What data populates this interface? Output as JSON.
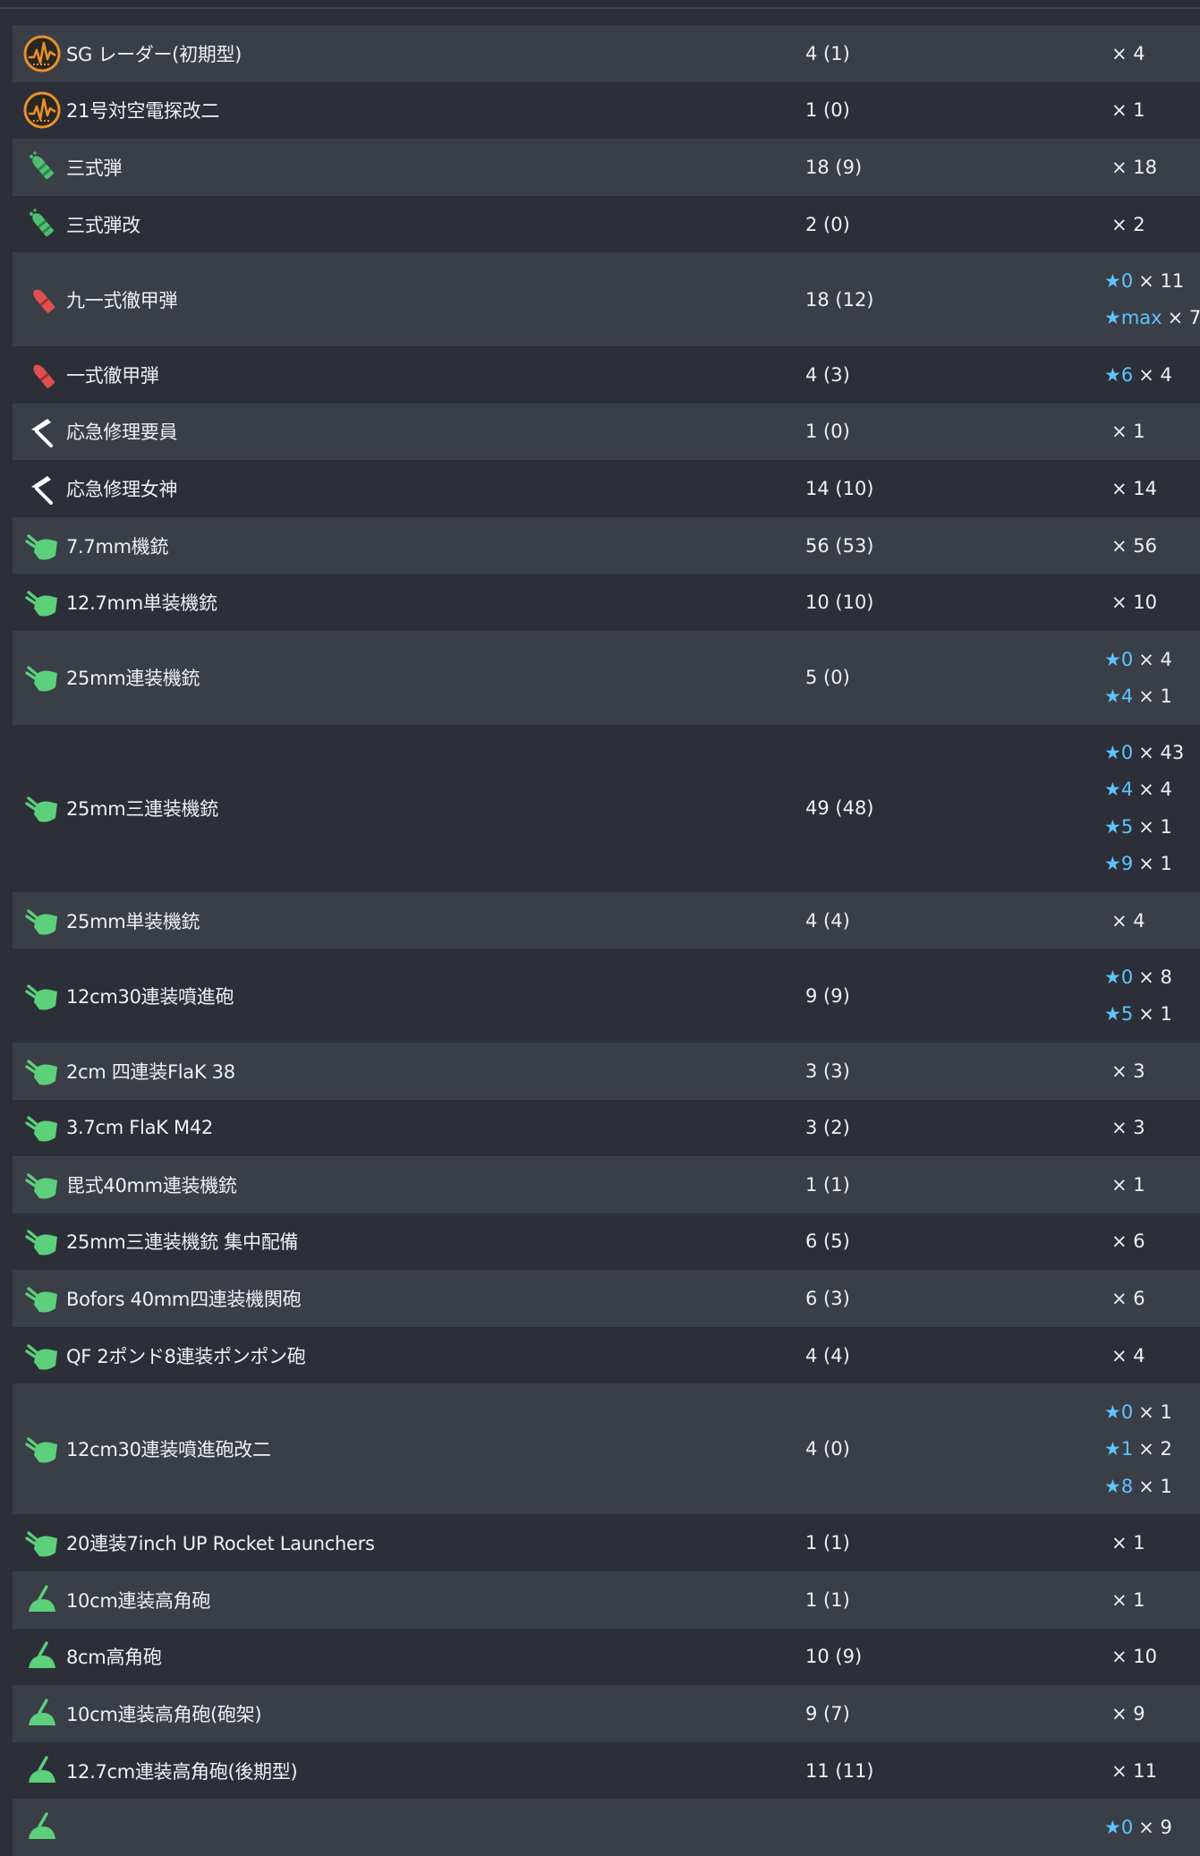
{
  "colors": {
    "row_alt": "#3a3e47",
    "row_base": "#2c2f38",
    "text": "#eef0f3",
    "star": "#5ec4ff",
    "radar_icon": "#e8902a",
    "shell_icon": "#4fc070",
    "ap_icon": "#e05050",
    "repair_icon": "#ffffff",
    "aa_icon": "#5cd07a"
  },
  "equipment": [
    {
      "icon": "radar-icon",
      "name": "SG レーダー(初期型)",
      "count": "4 (1)",
      "levels": [
        {
          "star": "",
          "mult": "× 4"
        }
      ]
    },
    {
      "icon": "radar-icon",
      "name": "21号対空電探改二",
      "count": "1 (0)",
      "levels": [
        {
          "star": "",
          "mult": "× 1"
        }
      ]
    },
    {
      "icon": "type3-shell-icon",
      "name": "三式弾",
      "count": "18 (9)",
      "levels": [
        {
          "star": "",
          "mult": "× 18"
        }
      ]
    },
    {
      "icon": "type3-shell-icon",
      "name": "三式弾改",
      "count": "2 (0)",
      "levels": [
        {
          "star": "",
          "mult": "× 2"
        }
      ]
    },
    {
      "icon": "ap-shell-icon",
      "name": "九一式徹甲弾",
      "count": "18 (12)",
      "levels": [
        {
          "star": "★0",
          "mult": "× 11"
        },
        {
          "star": "★max",
          "mult": "× 7"
        }
      ]
    },
    {
      "icon": "ap-shell-icon",
      "name": "一式徹甲弾",
      "count": "4 (3)",
      "levels": [
        {
          "star": "★6",
          "mult": "× 4"
        }
      ]
    },
    {
      "icon": "repair-icon",
      "name": "応急修理要員",
      "count": "1 (0)",
      "levels": [
        {
          "star": "",
          "mult": "× 1"
        }
      ]
    },
    {
      "icon": "repair-icon",
      "name": "応急修理女神",
      "count": "14 (10)",
      "levels": [
        {
          "star": "",
          "mult": "× 14"
        }
      ]
    },
    {
      "icon": "aa-gun-icon",
      "name": "7.7mm機銃",
      "count": "56 (53)",
      "levels": [
        {
          "star": "",
          "mult": "× 56"
        }
      ]
    },
    {
      "icon": "aa-gun-icon",
      "name": "12.7mm単装機銃",
      "count": "10 (10)",
      "levels": [
        {
          "star": "",
          "mult": "× 10"
        }
      ]
    },
    {
      "icon": "aa-gun-icon",
      "name": "25mm連装機銃",
      "count": "5 (0)",
      "levels": [
        {
          "star": "★0",
          "mult": "× 4"
        },
        {
          "star": "★4",
          "mult": "× 1"
        }
      ]
    },
    {
      "icon": "aa-gun-icon",
      "name": "25mm三連装機銃",
      "count": "49 (48)",
      "levels": [
        {
          "star": "★0",
          "mult": "× 43"
        },
        {
          "star": "★4",
          "mult": "× 4"
        },
        {
          "star": "★5",
          "mult": "× 1"
        },
        {
          "star": "★9",
          "mult": "× 1"
        }
      ]
    },
    {
      "icon": "aa-gun-icon",
      "name": "25mm単装機銃",
      "count": "4 (4)",
      "levels": [
        {
          "star": "",
          "mult": "× 4"
        }
      ]
    },
    {
      "icon": "aa-gun-icon",
      "name": "12cm30連装噴進砲",
      "count": "9 (9)",
      "levels": [
        {
          "star": "★0",
          "mult": "× 8"
        },
        {
          "star": "★5",
          "mult": "× 1"
        }
      ]
    },
    {
      "icon": "aa-gun-icon",
      "name": "2cm 四連装FlaK 38",
      "count": "3 (3)",
      "levels": [
        {
          "star": "",
          "mult": "× 3"
        }
      ]
    },
    {
      "icon": "aa-gun-icon",
      "name": "3.7cm FlaK M42",
      "count": "3 (2)",
      "levels": [
        {
          "star": "",
          "mult": "× 3"
        }
      ]
    },
    {
      "icon": "aa-gun-icon",
      "name": "毘式40mm連装機銃",
      "count": "1 (1)",
      "levels": [
        {
          "star": "",
          "mult": "× 1"
        }
      ]
    },
    {
      "icon": "aa-gun-icon",
      "name": "25mm三連装機銃 集中配備",
      "count": "6 (5)",
      "levels": [
        {
          "star": "",
          "mult": "× 6"
        }
      ]
    },
    {
      "icon": "aa-gun-icon",
      "name": "Bofors 40mm四連装機関砲",
      "count": "6 (3)",
      "levels": [
        {
          "star": "",
          "mult": "× 6"
        }
      ]
    },
    {
      "icon": "aa-gun-icon",
      "name": "QF 2ポンド8連装ポンポン砲",
      "count": "4 (4)",
      "levels": [
        {
          "star": "",
          "mult": "× 4"
        }
      ]
    },
    {
      "icon": "aa-gun-icon",
      "name": "12cm30連装噴進砲改二",
      "count": "4 (0)",
      "levels": [
        {
          "star": "★0",
          "mult": "× 1"
        },
        {
          "star": "★1",
          "mult": "× 2"
        },
        {
          "star": "★8",
          "mult": "× 1"
        }
      ]
    },
    {
      "icon": "aa-gun-icon",
      "name": "20連装7inch UP Rocket Launchers",
      "count": "1 (1)",
      "levels": [
        {
          "star": "",
          "mult": "× 1"
        }
      ]
    },
    {
      "icon": "ha-gun-icon",
      "name": "10cm連装高角砲",
      "count": "1 (1)",
      "levels": [
        {
          "star": "",
          "mult": "× 1"
        }
      ]
    },
    {
      "icon": "ha-gun-icon",
      "name": "8cm高角砲",
      "count": "10 (9)",
      "levels": [
        {
          "star": "",
          "mult": "× 10"
        }
      ]
    },
    {
      "icon": "ha-gun-icon",
      "name": "10cm連装高角砲(砲架)",
      "count": "9 (7)",
      "levels": [
        {
          "star": "",
          "mult": "× 9"
        }
      ]
    },
    {
      "icon": "ha-gun-icon",
      "name": "12.7cm連装高角砲(後期型)",
      "count": "11 (11)",
      "levels": [
        {
          "star": "",
          "mult": "× 11"
        }
      ]
    },
    {
      "icon": "ha-gun-icon",
      "name": "",
      "count": "",
      "levels": [
        {
          "star": "★0",
          "mult": "× 9"
        }
      ]
    }
  ]
}
